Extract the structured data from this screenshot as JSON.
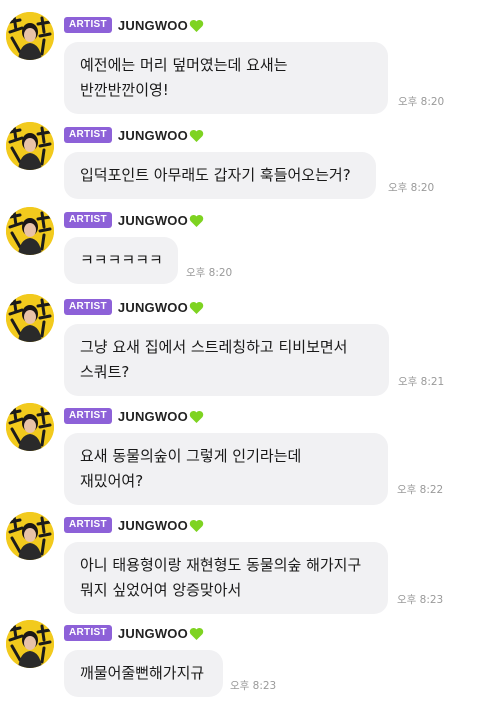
{
  "author": {
    "badge": "ARTIST",
    "name": "JUNGWOO",
    "heart_color": "#7ed321",
    "badge_color": "#8d61d8"
  },
  "messages": [
    {
      "lines": [
        "예전에는 머리 덮머였는데 요새는",
        "반깐반깐이영!"
      ],
      "time": "오후 8:20"
    },
    {
      "lines": [
        "입덕포인트 아무래도 갑자기 훅들어오는거?"
      ],
      "time": "오후 8:20"
    },
    {
      "lines": [
        "ㅋㅋㅋㅋㅋㅋ"
      ],
      "time": "오후 8:20"
    },
    {
      "lines": [
        "그냥 요새 집에서 스트레칭하고 티비보면서",
        "스쿼트?"
      ],
      "time": "오후 8:21"
    },
    {
      "lines": [
        "요새 동물의숲이 그렇게 인기라는데",
        "재밌어여?"
      ],
      "time": "오후 8:22"
    },
    {
      "lines": [
        "아니 태용형이랑 재현형도 동물의숲 해가지구",
        "뭐지 싶었어여 앙증맞아서"
      ],
      "time": "오후 8:23"
    },
    {
      "lines": [
        "깨물어줄뻔해가지규"
      ],
      "time": "오후 8:23"
    }
  ]
}
